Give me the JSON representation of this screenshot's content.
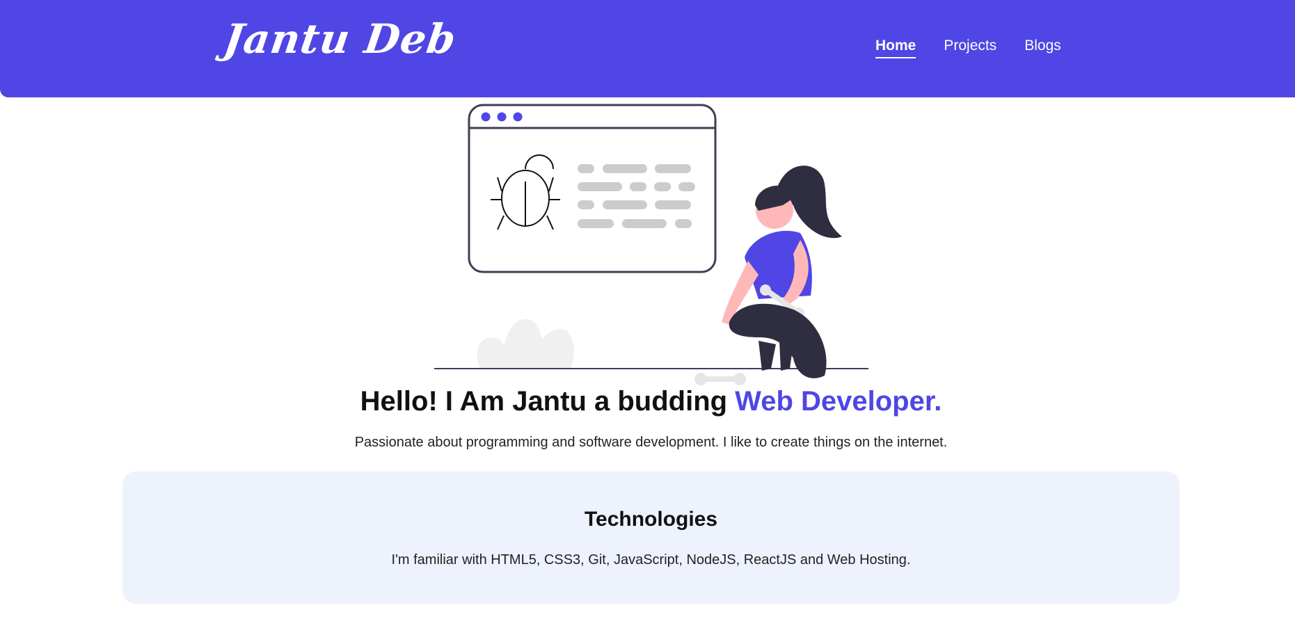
{
  "header": {
    "logo_text": "Jantu Deb",
    "nav": [
      {
        "label": "Home",
        "active": true
      },
      {
        "label": "Projects",
        "active": false
      },
      {
        "label": "Blogs",
        "active": false
      }
    ]
  },
  "hero": {
    "title_prefix": "Hello! I Am Jantu a budding ",
    "title_accent": "Web Developer.",
    "subtitle": "Passionate about programming and software development. I like to create things on the internet."
  },
  "technologies": {
    "title": "Technologies",
    "text": "I'm familiar with HTML5, CSS3, Git, JavaScript, NodeJS, ReactJS and Web Hosting."
  },
  "colors": {
    "brand": "#4f46e5",
    "card_bg": "#eef2fc",
    "text": "#111111"
  },
  "icons": [
    "bug-icon",
    "wrench-icon",
    "developer-illustration"
  ]
}
